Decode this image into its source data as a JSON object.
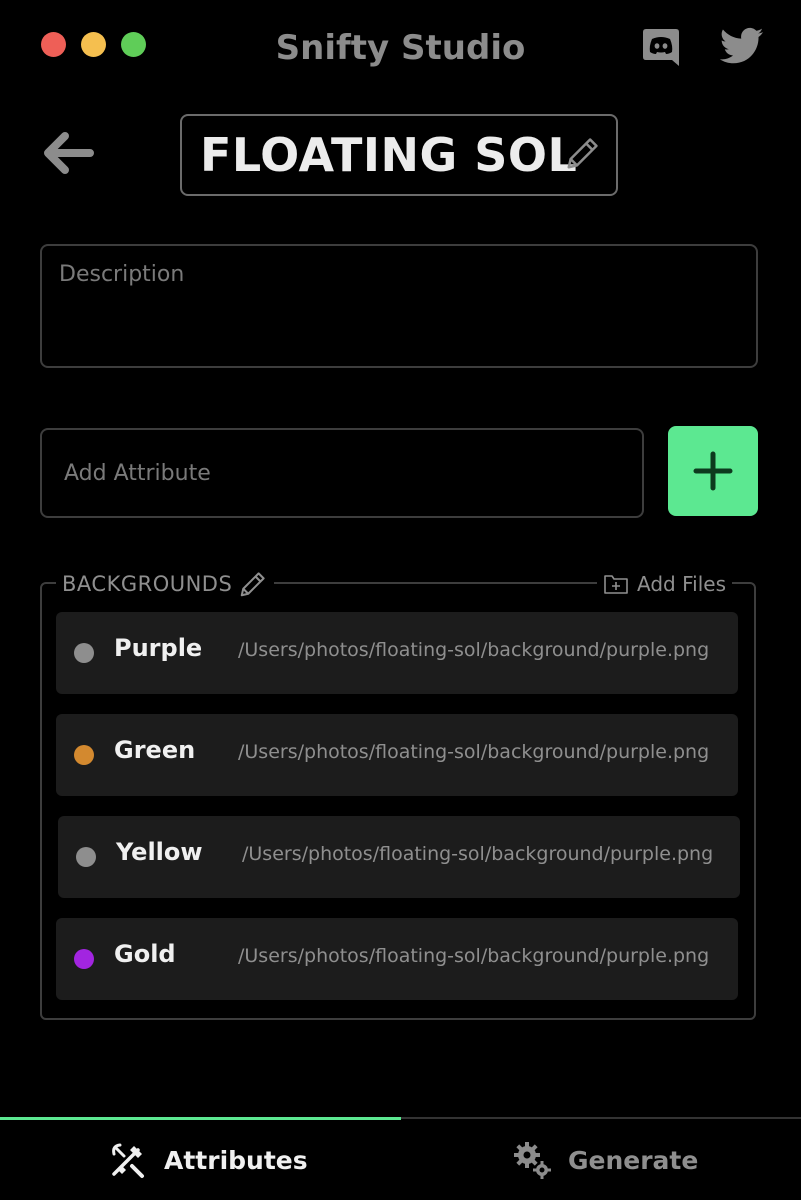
{
  "window": {
    "title": "Snifty Studio"
  },
  "header": {
    "collection_name": "FLOATING SOL"
  },
  "description": {
    "placeholder": "Description",
    "value": ""
  },
  "attribute_input": {
    "placeholder": "Add Attribute",
    "value": ""
  },
  "add_button": {
    "symbol": "+"
  },
  "attribute": {
    "label": "BACKGROUNDS",
    "add_files_label": "Add Files",
    "items": [
      {
        "name": "Purple",
        "path": "/Users/photos/floating-sol/background/purple.png",
        "color": "#8e8e8e"
      },
      {
        "name": "Green",
        "path": "/Users/photos/floating-sol/background/purple.png",
        "color": "#d3892f"
      },
      {
        "name": "Yellow",
        "path": "/Users/photos/floating-sol/background/purple.png",
        "color": "#8e8e8e"
      },
      {
        "name": "Gold",
        "path": "/Users/photos/floating-sol/background/purple.png",
        "color": "#a225e0"
      }
    ]
  },
  "tabs": [
    {
      "label": "Attributes",
      "icon": "tools-icon",
      "active": true
    },
    {
      "label": "Generate",
      "icon": "gears-icon",
      "active": false
    }
  ],
  "progress": 0.5,
  "colors": {
    "accent": "#5ce891",
    "background": "#000000",
    "card": "#1c1c1c",
    "muted": "#8f8f8f"
  }
}
